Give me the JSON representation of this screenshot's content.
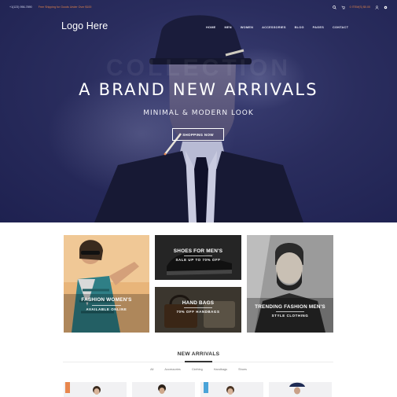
{
  "topbar": {
    "phone": "+1(123) 956-7890",
    "promo": "Free Shipping for Goods Under Over $100",
    "cart_text": "0 ITEM(S) $0.00",
    "icons": [
      "search-icon",
      "cart-icon",
      "user-icon",
      "settings-icon"
    ]
  },
  "header": {
    "logo": "Logo Here",
    "nav": [
      "HOME",
      "MEN",
      "WOMEN",
      "ACCESSORIES",
      "BLOG",
      "PAGES",
      "CONTACT"
    ]
  },
  "hero": {
    "background_word": "COLLECTION",
    "title": "A BRAND NEW ARRIVALS",
    "subtitle": "MINIMAL & MODERN LOOK",
    "button": "SHOPPING NOW",
    "background_color": "#2a2d5e"
  },
  "categories": [
    {
      "title": "FASHION WOMEN'S",
      "subtitle": "AVAILABLE ONLINE"
    },
    {
      "title": "SHOES FOR MEN'S",
      "subtitle": "SALE UP TO 70% OFF"
    },
    {
      "title": "HAND BAGS",
      "subtitle": "70% OFF HANDBAGS"
    },
    {
      "title": "TRENDING FASHION MEN'S",
      "subtitle": "STYLE CLOTHING"
    }
  ],
  "new_arrivals": {
    "title": "NEW ARRIVALS",
    "filters": [
      "All",
      "Accessories",
      "Clothing",
      "Handbags",
      "Shoes"
    ],
    "badge_colors": [
      "#e8874e",
      "#4aa3d8"
    ]
  }
}
